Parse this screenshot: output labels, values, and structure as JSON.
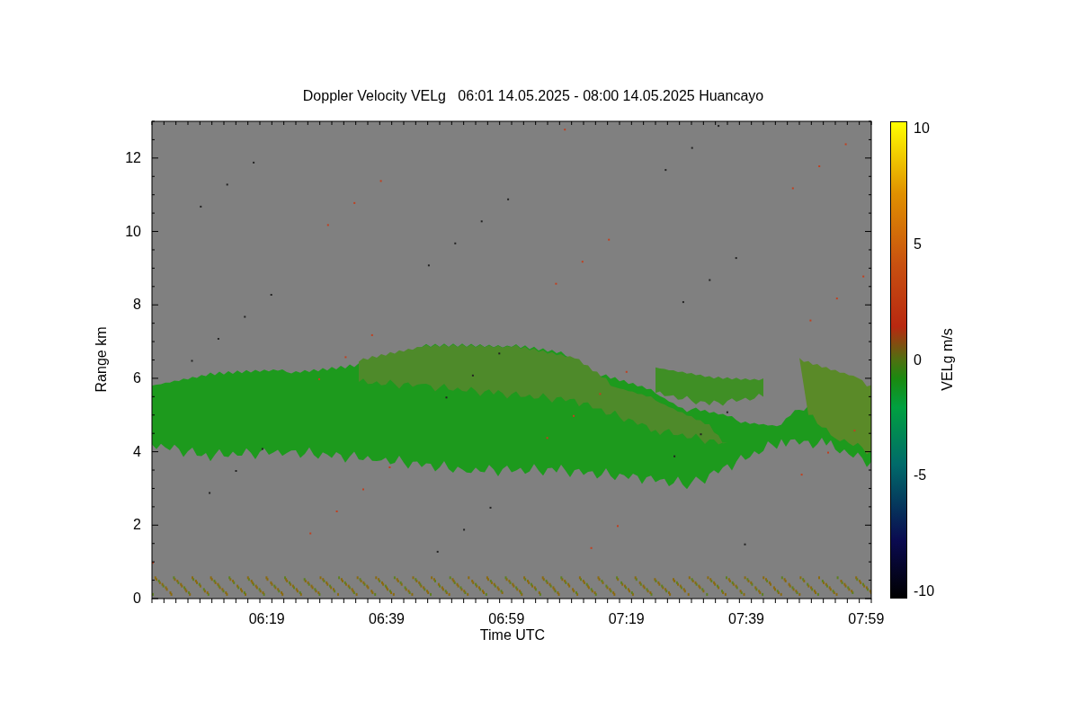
{
  "plot": {
    "title": "Doppler Velocity VELg   06:01 14.05.2025 - 08:00 14.05.2025 Huancayo",
    "xlabel": "Time UTC",
    "ylabel": "Range km",
    "xticks": [
      "06:19",
      "06:39",
      "06:59",
      "07:19",
      "07:39",
      "07:59"
    ],
    "yticks": [
      "12",
      "10",
      "8",
      "6",
      "4",
      "2",
      "0"
    ]
  },
  "colorbar": {
    "label": "VELg m/s",
    "ticks": [
      "10",
      "5",
      "0",
      "-5",
      "-10"
    ]
  }
}
